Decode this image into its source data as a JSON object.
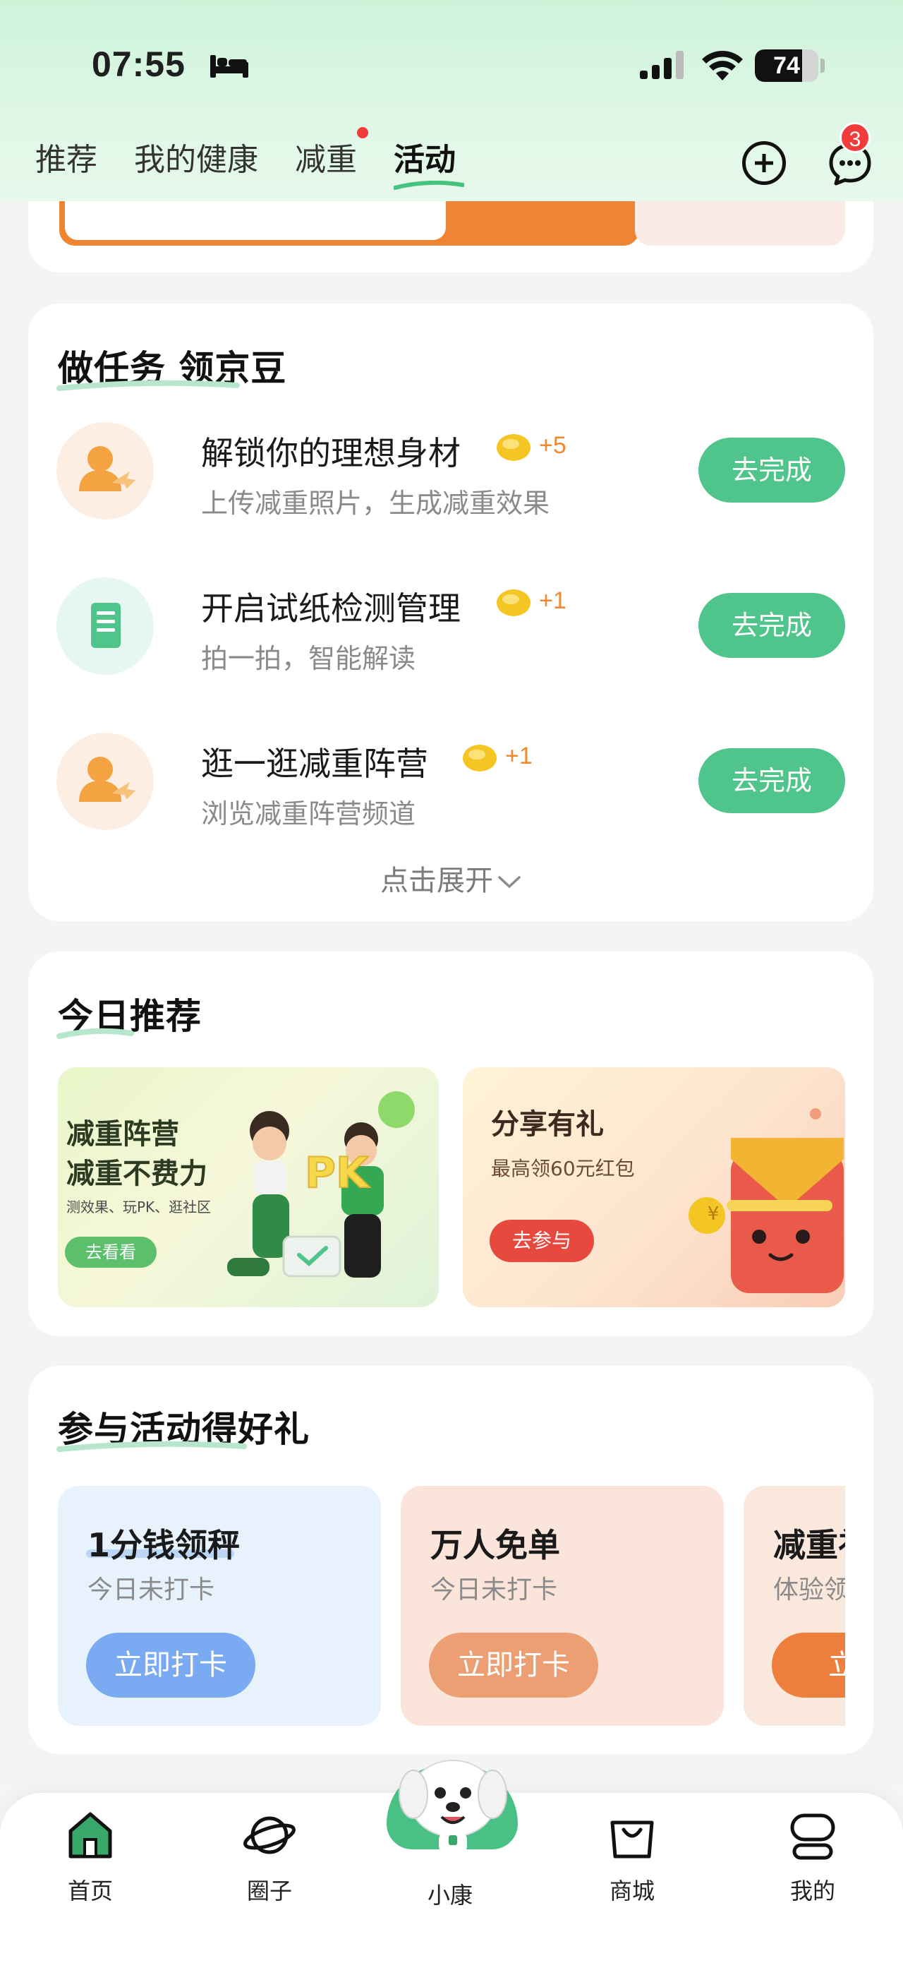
{
  "status_bar": {
    "time": "07:55",
    "battery": "74",
    "battery_level": 0.74
  },
  "top_tabs": [
    {
      "label": "推荐",
      "active": false
    },
    {
      "label": "我的健康",
      "active": false
    },
    {
      "label": "减重",
      "active": false,
      "has_dot": true
    },
    {
      "label": "活动",
      "active": true
    }
  ],
  "header_actions": {
    "add_icon": "plus-circle-icon",
    "message_icon": "chat-bubble-icon",
    "message_badge": "3"
  },
  "tasks_section": {
    "title": "做任务 领京豆",
    "tasks": [
      {
        "title": "解锁你的理想身材",
        "points": "+5",
        "subtitle": "上传减重照片，生成减重效果",
        "button": "去完成",
        "icon": "person-share-icon"
      },
      {
        "title": "开启试纸检测管理",
        "points": "+1",
        "subtitle": "拍一拍，智能解读",
        "button": "去完成",
        "icon": "test-strip-icon"
      },
      {
        "title": "逛一逛减重阵营",
        "points": "+1",
        "subtitle": "浏览减重阵营频道",
        "button": "去完成",
        "icon": "person-share-icon"
      }
    ],
    "expand_label": "点击展开"
  },
  "recommend_section": {
    "title": "今日推荐",
    "banner_left": {
      "title_line1": "减重阵营",
      "title_line2": "减重不费力",
      "subtitle": "测效果、玩PK、逛社区",
      "button": "去看看",
      "badge": "PK"
    },
    "banner_right": {
      "title": "分享有礼",
      "subtitle": "最高领60元红包",
      "button": "去参与",
      "coin": "¥"
    }
  },
  "activity_section": {
    "title": "参与活动得好礼",
    "items": [
      {
        "title": "1分钱领秤",
        "subtitle": "今日未打卡",
        "button": "立即打卡",
        "bg": "#e7f2fc",
        "btn_color": "#79aaf2"
      },
      {
        "title": "万人免单",
        "subtitle": "今日未打卡",
        "button": "立即打卡",
        "bg": "#fbe5da",
        "btn_color": "#eb9f72"
      },
      {
        "title": "减重礼",
        "subtitle": "体验领",
        "button": "立即",
        "bg": "#fbe8dd",
        "btn_color": "#ee7f3d"
      }
    ]
  },
  "bottom_nav": [
    {
      "label": "首页",
      "icon": "home-icon"
    },
    {
      "label": "圈子",
      "icon": "planet-icon"
    },
    {
      "label": "小康",
      "icon": "mascot-icon"
    },
    {
      "label": "商城",
      "icon": "shopping-bag-icon"
    },
    {
      "label": "我的",
      "icon": "profile-icon"
    }
  ],
  "colors": {
    "accent_green": "#4fc58c",
    "points_orange": "#ef8a2f",
    "badge_red": "#f23b3b"
  }
}
